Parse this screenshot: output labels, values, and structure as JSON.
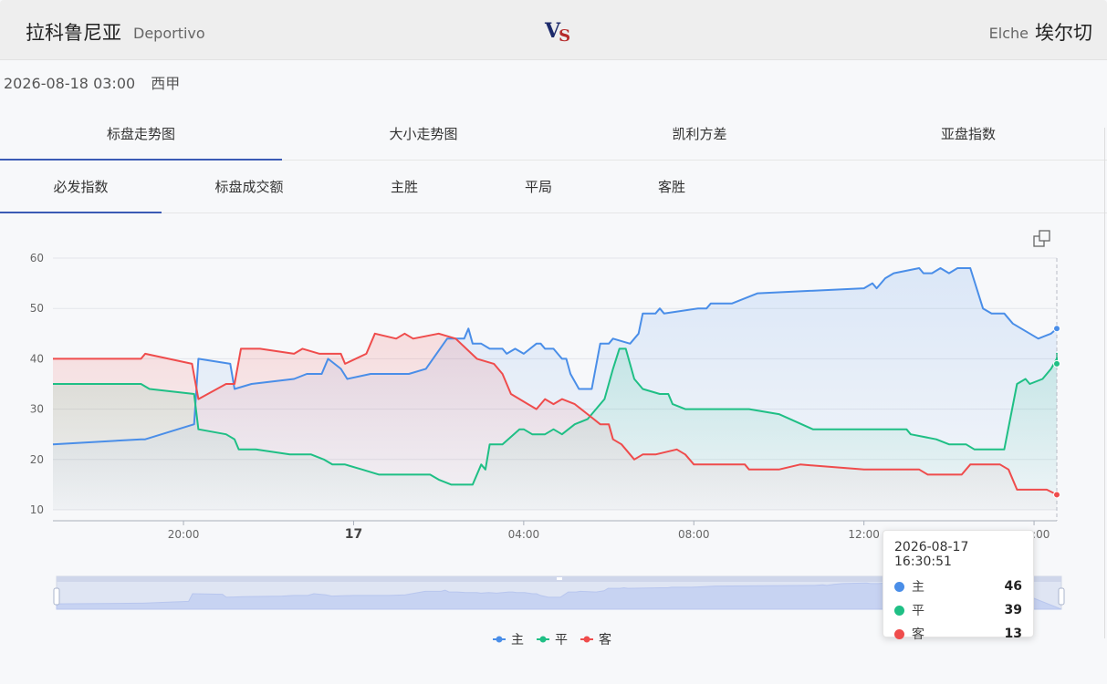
{
  "match": {
    "home_name": "拉科鲁尼亚",
    "home_en": "Deportivo",
    "vs_v": "V",
    "vs_s": "S",
    "away_en": "Elche",
    "away_name": "埃尔切",
    "datetime": "2026-08-18 03:00",
    "league": "西甲"
  },
  "tabs_main": [
    "标盘走势图",
    "大小走势图",
    "凯利方差",
    "亚盘指数"
  ],
  "tabs_sub": [
    "必发指数",
    "标盘成交额",
    "主胜",
    "平局",
    "客胜"
  ],
  "icons": {
    "restore": "restore-icon"
  },
  "tooltip": {
    "title": "2026-08-17 16:30:51",
    "rows": [
      {
        "name": "主",
        "value": "46",
        "color": "#4a8ee8"
      },
      {
        "name": "平",
        "value": "39",
        "color": "#1fbf85"
      },
      {
        "name": "客",
        "value": "13",
        "color": "#ef4c4c"
      }
    ]
  },
  "chart_data": {
    "type": "line",
    "y_range": [
      10,
      60
    ],
    "y_ticks": [
      10,
      20,
      30,
      40,
      50,
      60
    ],
    "x_range_hours": [
      16.93,
      27.77
    ],
    "x_ticks": [
      {
        "t": 20.0,
        "label": "20:00",
        "bold": false
      },
      {
        "t": 24.0,
        "label": "17",
        "bold": true
      },
      {
        "t": 28.0,
        "label": "04:00",
        "bold": false
      },
      {
        "t": 32.0,
        "label": "08:00",
        "bold": false
      },
      {
        "t": 36.0,
        "label": "12:00",
        "bold": false
      },
      {
        "t": 40.0,
        "label": "16:00",
        "bold": false
      }
    ],
    "grid": true,
    "legend_position": "bottom-center",
    "series": [
      {
        "name": "主",
        "color": "#4a8ee8",
        "points": [
          [
            16.93,
            23
          ],
          [
            19.0,
            24
          ],
          [
            19.1,
            24
          ],
          [
            20.25,
            27
          ],
          [
            20.35,
            40
          ],
          [
            21.1,
            39
          ],
          [
            21.2,
            34
          ],
          [
            21.6,
            35
          ],
          [
            22.6,
            36
          ],
          [
            22.9,
            37
          ],
          [
            23.25,
            37
          ],
          [
            23.4,
            40
          ],
          [
            23.7,
            38
          ],
          [
            23.85,
            36
          ],
          [
            24.4,
            37
          ],
          [
            25.3,
            37
          ],
          [
            25.7,
            38
          ],
          [
            26.2,
            44
          ],
          [
            26.6,
            44
          ],
          [
            26.7,
            46
          ],
          [
            26.8,
            43
          ],
          [
            27.0,
            43
          ],
          [
            27.2,
            42
          ],
          [
            27.5,
            42
          ],
          [
            27.6,
            41
          ],
          [
            27.8,
            42
          ],
          [
            28.0,
            41
          ],
          [
            28.3,
            43
          ],
          [
            28.4,
            43
          ],
          [
            28.5,
            42
          ],
          [
            28.7,
            42
          ],
          [
            28.9,
            40
          ],
          [
            29.0,
            40
          ],
          [
            29.1,
            37
          ],
          [
            29.3,
            34
          ],
          [
            29.6,
            34
          ],
          [
            29.8,
            43
          ],
          [
            30.0,
            43
          ],
          [
            30.1,
            44
          ],
          [
            30.5,
            43
          ],
          [
            30.7,
            45
          ],
          [
            30.8,
            49
          ],
          [
            31.1,
            49
          ],
          [
            31.2,
            50
          ],
          [
            31.3,
            49
          ],
          [
            32.1,
            50
          ],
          [
            32.3,
            50
          ],
          [
            32.4,
            51
          ],
          [
            32.8,
            51
          ],
          [
            32.9,
            51
          ],
          [
            33.5,
            53
          ],
          [
            36.0,
            54
          ],
          [
            36.2,
            55
          ],
          [
            36.3,
            54
          ],
          [
            36.5,
            56
          ],
          [
            36.7,
            57
          ],
          [
            37.3,
            58
          ],
          [
            37.4,
            57
          ],
          [
            37.6,
            57
          ],
          [
            37.8,
            58
          ],
          [
            38.0,
            57
          ],
          [
            38.2,
            58
          ],
          [
            38.5,
            58
          ],
          [
            38.8,
            50
          ],
          [
            39.0,
            49
          ],
          [
            39.3,
            49
          ],
          [
            39.5,
            47
          ],
          [
            40.1,
            44
          ],
          [
            40.4,
            45
          ],
          [
            41.0,
            46
          ]
        ]
      },
      {
        "name": "平",
        "color": "#1fbf85",
        "points": [
          [
            16.93,
            35
          ],
          [
            19.0,
            35
          ],
          [
            19.2,
            34
          ],
          [
            20.25,
            33
          ],
          [
            20.35,
            26
          ],
          [
            21.0,
            25
          ],
          [
            21.2,
            24
          ],
          [
            21.3,
            22
          ],
          [
            21.7,
            22
          ],
          [
            22.5,
            21
          ],
          [
            23.0,
            21
          ],
          [
            23.3,
            20
          ],
          [
            23.5,
            19
          ],
          [
            23.8,
            19
          ],
          [
            24.2,
            18
          ],
          [
            24.6,
            17
          ],
          [
            25.8,
            17
          ],
          [
            26.0,
            16
          ],
          [
            26.3,
            15
          ],
          [
            26.8,
            15
          ],
          [
            27.0,
            19
          ],
          [
            27.1,
            18
          ],
          [
            27.2,
            23
          ],
          [
            27.5,
            23
          ],
          [
            27.9,
            26
          ],
          [
            28.0,
            26
          ],
          [
            28.2,
            25
          ],
          [
            28.5,
            25
          ],
          [
            28.7,
            26
          ],
          [
            28.9,
            25
          ],
          [
            29.2,
            27
          ],
          [
            29.5,
            28
          ],
          [
            29.8,
            31
          ],
          [
            29.9,
            32
          ],
          [
            30.1,
            38
          ],
          [
            30.25,
            42
          ],
          [
            30.4,
            42
          ],
          [
            30.6,
            36
          ],
          [
            30.8,
            34
          ],
          [
            31.2,
            33
          ],
          [
            31.4,
            33
          ],
          [
            31.5,
            31
          ],
          [
            31.8,
            30
          ],
          [
            32.0,
            30
          ],
          [
            32.5,
            30
          ],
          [
            33.3,
            30
          ],
          [
            34.0,
            29
          ],
          [
            34.8,
            26
          ],
          [
            36.0,
            26
          ],
          [
            37.0,
            26
          ],
          [
            37.1,
            25
          ],
          [
            37.7,
            24
          ],
          [
            38.0,
            23
          ],
          [
            38.4,
            23
          ],
          [
            38.6,
            22
          ],
          [
            39.3,
            22
          ],
          [
            39.6,
            35
          ],
          [
            39.8,
            36
          ],
          [
            39.9,
            35
          ],
          [
            40.2,
            36
          ],
          [
            40.4,
            38
          ],
          [
            40.9,
            40
          ],
          [
            41.2,
            41
          ],
          [
            41.5,
            41
          ],
          [
            42.0,
            40
          ],
          [
            42.2,
            39
          ]
        ]
      },
      {
        "name": "客",
        "color": "#ef4c4c",
        "points": [
          [
            16.93,
            40
          ],
          [
            19.0,
            40
          ],
          [
            19.1,
            41
          ],
          [
            20.2,
            39
          ],
          [
            20.35,
            32
          ],
          [
            21.0,
            35
          ],
          [
            21.2,
            35
          ],
          [
            21.35,
            42
          ],
          [
            21.8,
            42
          ],
          [
            22.6,
            41
          ],
          [
            22.8,
            42
          ],
          [
            23.2,
            41
          ],
          [
            23.7,
            41
          ],
          [
            23.8,
            39
          ],
          [
            24.3,
            41
          ],
          [
            24.5,
            45
          ],
          [
            25.0,
            44
          ],
          [
            25.2,
            45
          ],
          [
            25.4,
            44
          ],
          [
            26.0,
            45
          ],
          [
            26.4,
            44
          ],
          [
            26.9,
            40
          ],
          [
            27.3,
            39
          ],
          [
            27.5,
            37
          ],
          [
            27.7,
            33
          ],
          [
            28.1,
            31
          ],
          [
            28.3,
            30
          ],
          [
            28.5,
            32
          ],
          [
            28.7,
            31
          ],
          [
            28.9,
            32
          ],
          [
            29.2,
            31
          ],
          [
            29.5,
            29
          ],
          [
            29.8,
            27
          ],
          [
            30.0,
            27
          ],
          [
            30.1,
            24
          ],
          [
            30.3,
            23
          ],
          [
            30.6,
            20
          ],
          [
            30.8,
            21
          ],
          [
            31.1,
            21
          ],
          [
            31.6,
            22
          ],
          [
            31.8,
            21
          ],
          [
            32.0,
            19
          ],
          [
            32.5,
            19
          ],
          [
            32.7,
            19
          ],
          [
            33.2,
            19
          ],
          [
            33.3,
            18
          ],
          [
            34.0,
            18
          ],
          [
            34.5,
            19
          ],
          [
            36.0,
            18
          ],
          [
            37.3,
            18
          ],
          [
            37.5,
            17
          ],
          [
            38.3,
            17
          ],
          [
            38.5,
            19
          ],
          [
            39.0,
            19
          ],
          [
            39.2,
            19
          ],
          [
            39.4,
            18
          ],
          [
            39.6,
            14
          ],
          [
            40.3,
            14
          ],
          [
            41.0,
            13
          ],
          [
            42.2,
            13
          ]
        ]
      }
    ]
  }
}
